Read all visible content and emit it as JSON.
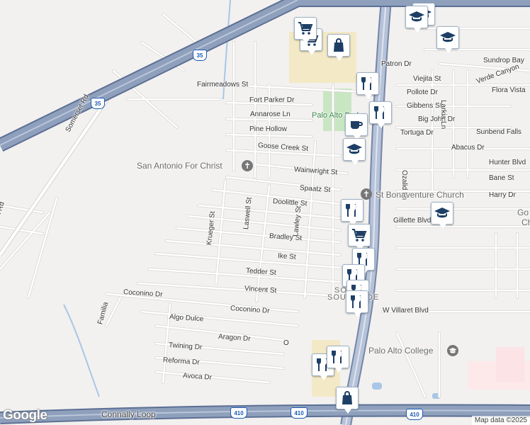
{
  "map": {
    "attribution": "Map data ©2025",
    "logo": "Google",
    "colors": {
      "background": "#f2f1ef",
      "freeway": "#8fa0bc",
      "freeway_edge": "#7585a6",
      "street": "#ffffff",
      "street_edge": "#d6d4d0",
      "park": "#c8e6c2",
      "commercial": "#f3e9c6",
      "water": "#a9c6e6",
      "pin_icon": "#1d3f66"
    },
    "highways": [
      {
        "label": "35"
      },
      {
        "label": "35"
      },
      {
        "label": "410"
      },
      {
        "label": "410"
      },
      {
        "label": "410"
      }
    ],
    "streets": [
      "Fairmeadows St",
      "Fort Parker Dr",
      "Annarose Ln",
      "Pine Hollow",
      "Goose Creek St",
      "Wainwright St",
      "Spaatz St",
      "Doolittle St",
      "Bradley St",
      "Ike St",
      "Tedder St",
      "Vincent St",
      "Coconino Dr",
      "Coconino Dr",
      "Algo Dulce",
      "Aragon Dr",
      "Twining Dr",
      "Reforma Dr",
      "Avoca Dr",
      "Connally Loop",
      "Krueger St",
      "Laswell St",
      "Lawley St",
      "Somerset Rd",
      "Somerset Rd",
      "Familia",
      "Patron Dr",
      "Viejita St",
      "Pollote Dr",
      "Gibbens St",
      "Big John Dr",
      "Tortuga Dr",
      "Larkia Ln",
      "Ozalid Ln",
      "Abacus Dr",
      "Sundrop Bay",
      "Verde Canyon",
      "Flora Vista",
      "Sunbend Falls",
      "Hunter Blvd",
      "Bane St",
      "Harry Dr",
      "Gillette Blvd",
      "W Villaret Blvd",
      "O"
    ],
    "places": {
      "church1": "San Antonio For Christ",
      "church2": "St Bonaventure Church",
      "park": "Palo Alto Park",
      "college": "Palo Alto College",
      "south1": "SOUTH",
      "south2": "SOUTHSIDE",
      "go": "Go",
      "ch": "Ch"
    },
    "pins": [
      {
        "icon": "shopping-bag-icon"
      },
      {
        "icon": "shopping-cart-icon"
      },
      {
        "icon": "shopping-cart-icon"
      },
      {
        "icon": "school-icon"
      },
      {
        "icon": "school-icon"
      },
      {
        "icon": "restaurant-icon"
      },
      {
        "icon": "school-icon"
      },
      {
        "icon": "cafe-icon"
      },
      {
        "icon": "restaurant-icon"
      },
      {
        "icon": "school-icon"
      },
      {
        "icon": "restaurant-icon"
      },
      {
        "icon": "shopping-cart-icon"
      },
      {
        "icon": "restaurant-icon"
      },
      {
        "icon": "restaurant-icon"
      },
      {
        "icon": "restaurant-icon"
      },
      {
        "icon": "school-icon"
      },
      {
        "icon": "restaurant-icon"
      },
      {
        "icon": "restaurant-icon"
      },
      {
        "icon": "restaurant-icon"
      },
      {
        "icon": "shopping-bag-icon"
      }
    ]
  }
}
